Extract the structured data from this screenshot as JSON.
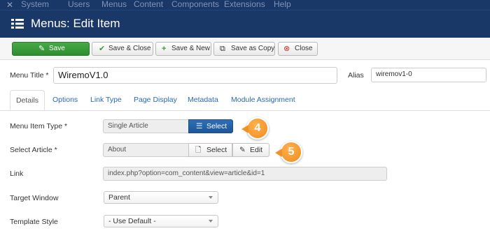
{
  "topbar": {
    "menu": [
      "System",
      "Users",
      "Menus",
      "Content",
      "Components",
      "Extensions",
      "Help"
    ]
  },
  "header": {
    "title": "Menus: Edit Item"
  },
  "toolbar": {
    "save": "Save",
    "save_close": "Save & Close",
    "save_new": "Save & New",
    "save_copy": "Save as Copy",
    "close": "Close"
  },
  "form": {
    "menu_title_label": "Menu Title *",
    "menu_title_value": "WiremoV1.0",
    "alias_label": "Alias",
    "alias_value": "wiremov1-0"
  },
  "tabs": [
    "Details",
    "Options",
    "Link Type",
    "Page Display",
    "Metadata",
    "Module Assignment"
  ],
  "details": {
    "item_type_label": "Menu Item Type *",
    "item_type_value": "Single Article",
    "item_type_select": "Select",
    "article_label": "Select Article *",
    "article_value": "About",
    "article_select": "Select",
    "article_edit": "Edit",
    "link_label": "Link",
    "link_value": "index.php?option=com_content&view=article&id=1",
    "target_label": "Target Window",
    "target_value": "Parent",
    "template_label": "Template Style",
    "template_value": "- Use Default -"
  },
  "callouts": [
    "4",
    "5"
  ],
  "colors": {
    "navbar": "#1a3867",
    "save_green": "#3a9a3a",
    "select_blue": "#2563a8",
    "callout_orange": "#f29124",
    "link_blue": "#2a69b8"
  }
}
